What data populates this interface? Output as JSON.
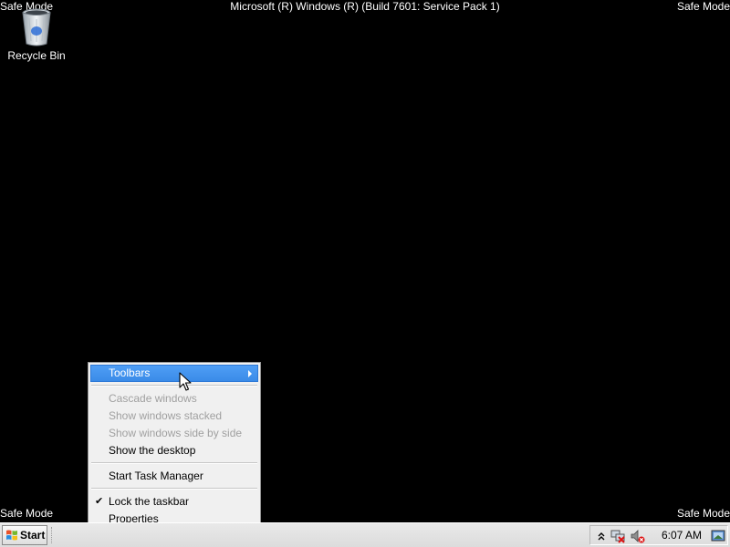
{
  "desktop": {
    "background_color": "#000000",
    "watermark": {
      "top_left": "Safe Mode",
      "top_right": "Safe Mode",
      "bottom_left": "Safe Mode",
      "bottom_right": "Safe Mode",
      "title": "Microsoft (R) Windows (R) (Build 7601: Service Pack 1)"
    },
    "icons": [
      {
        "label": "Recycle Bin",
        "icon": "recycle-bin-icon"
      }
    ]
  },
  "context_menu": {
    "items": [
      {
        "label": "Toolbars",
        "state": "highlighted",
        "submenu": true
      },
      {
        "label": "Cascade windows",
        "state": "disabled"
      },
      {
        "label": "Show windows stacked",
        "state": "disabled"
      },
      {
        "label": "Show windows side by side",
        "state": "disabled"
      },
      {
        "label": "Show the desktop",
        "state": "enabled"
      },
      {
        "label": "Start Task Manager",
        "state": "enabled"
      },
      {
        "label": "Lock the taskbar",
        "state": "enabled",
        "checked": true
      },
      {
        "label": "Properties",
        "state": "enabled"
      }
    ],
    "check_mark": "✔",
    "highlight_color": "#3a8be8"
  },
  "taskbar": {
    "start_label": "Start",
    "start_icon": "windows-logo-icon",
    "tray": {
      "icons": [
        "show-hidden-icons-icon",
        "network-disconnected-icon",
        "volume-muted-icon"
      ],
      "clock": "6:07 AM",
      "show_desktop_icon": "show-desktop-icon"
    }
  }
}
